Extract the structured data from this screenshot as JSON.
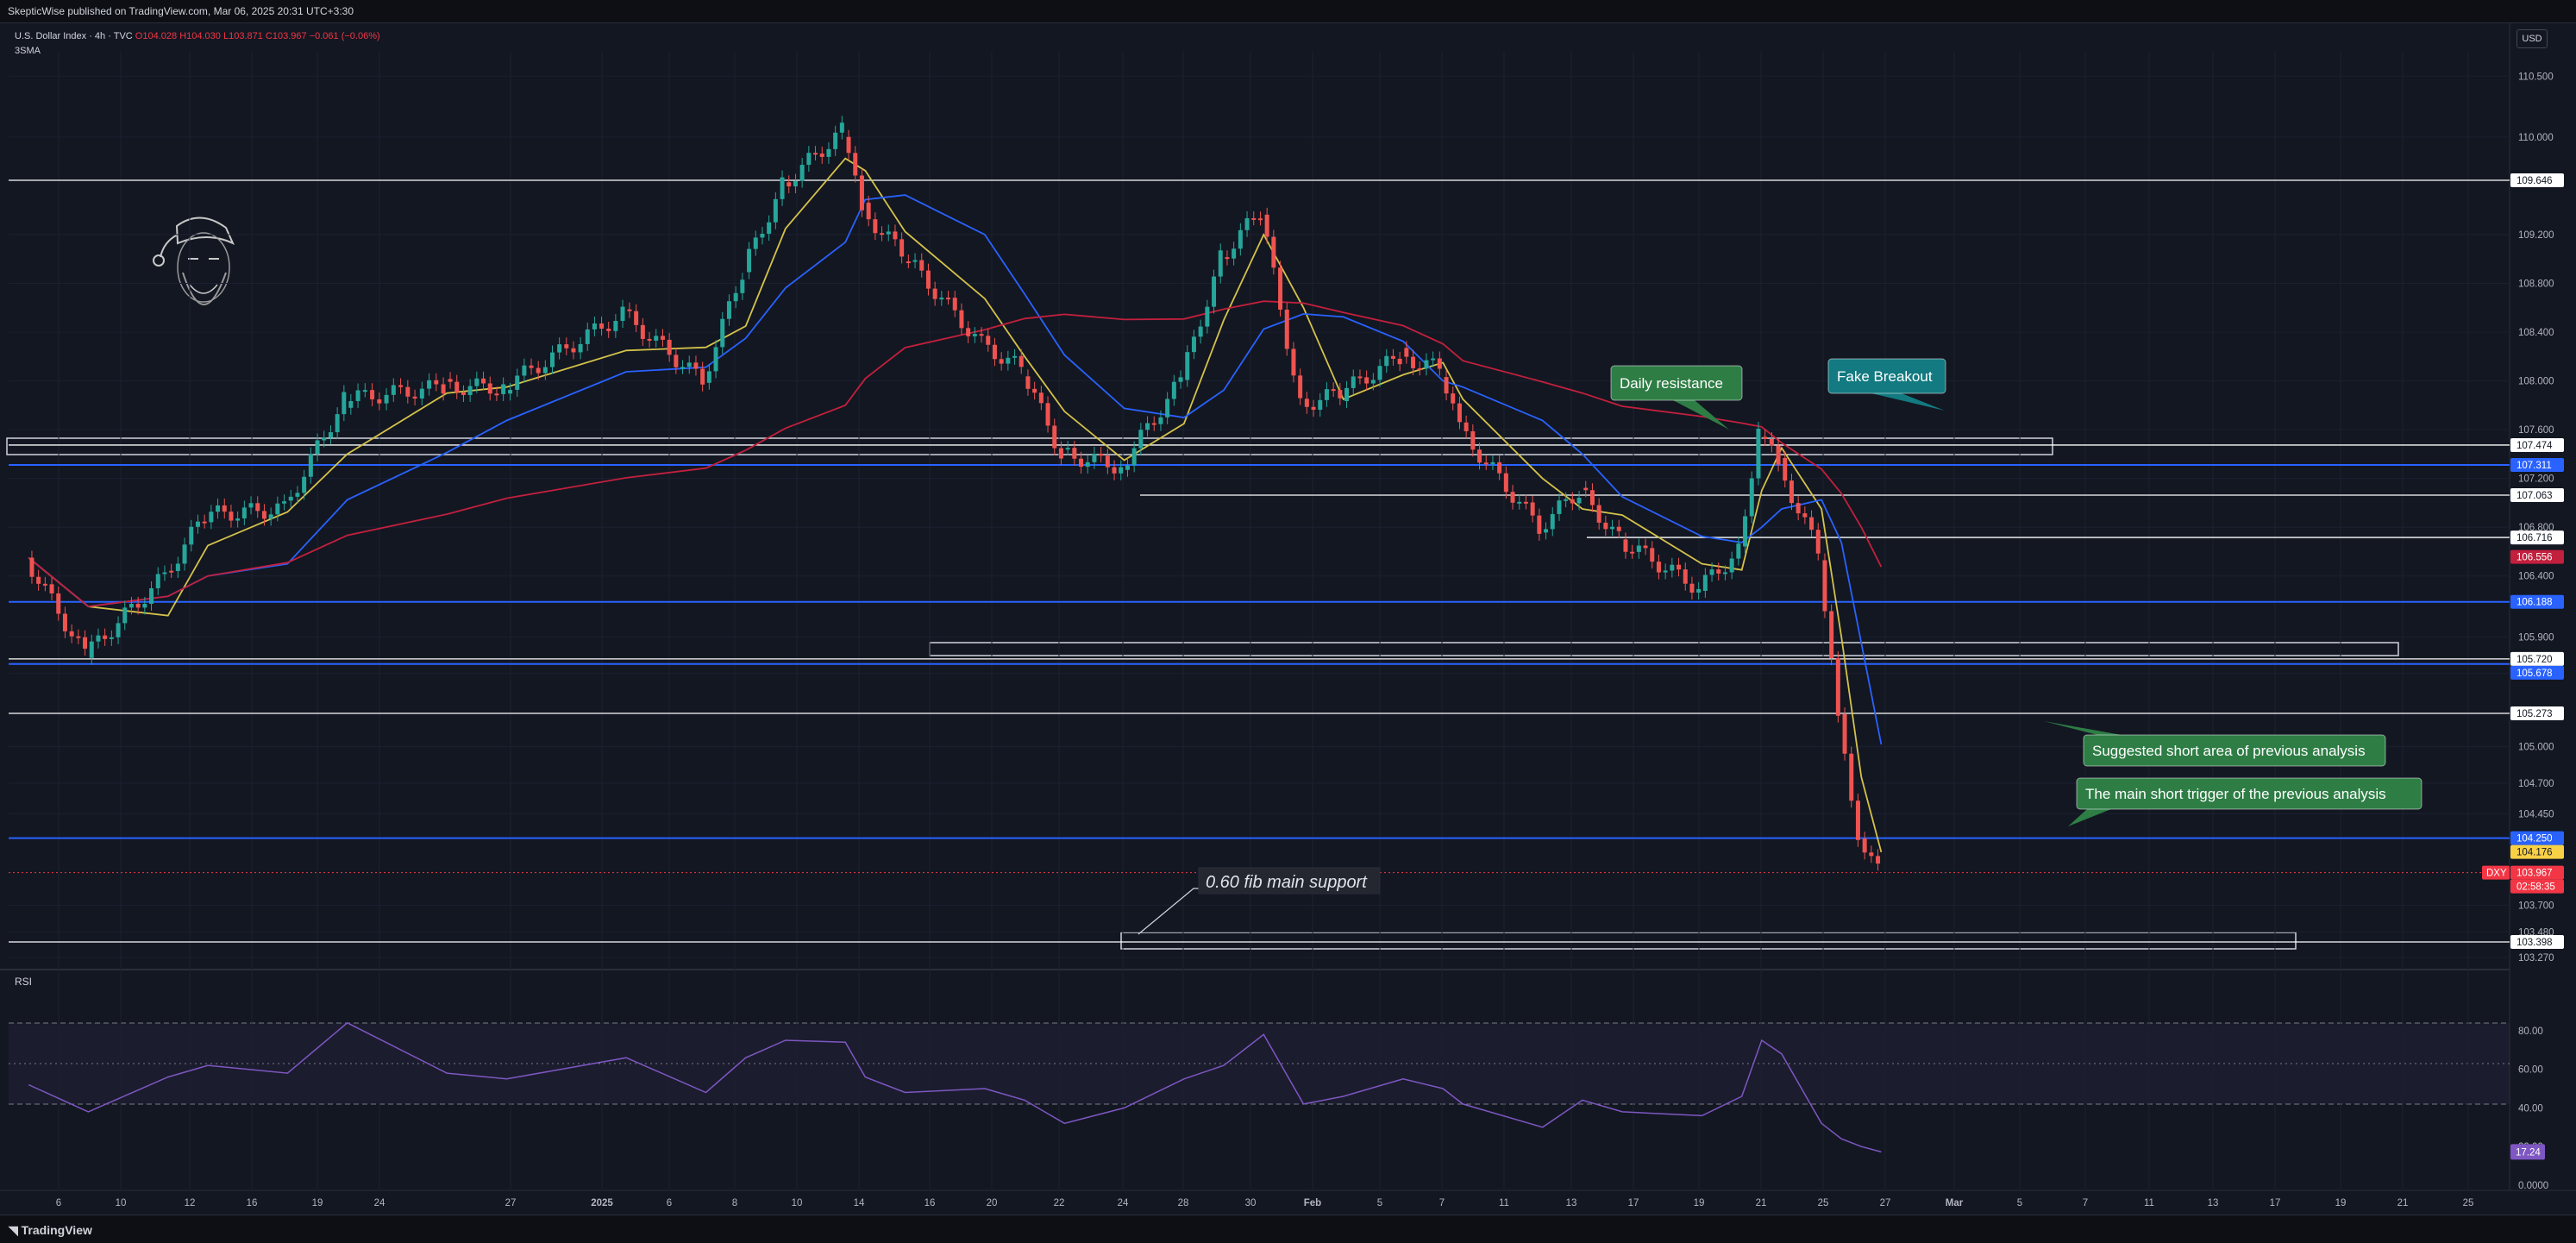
{
  "header": {
    "publish_line": "SkepticWise published on TradingView.com, Mar 06, 2025 20:31 UTC+3:30"
  },
  "legend": {
    "symbol": "U.S. Dollar Index · 4h · TVC",
    "open": "O104.028",
    "high": "H104.030",
    "low": "L103.871",
    "close": "C103.967",
    "change": "−0.061 (−0.06%)",
    "indicator": "3SMA"
  },
  "currency_button": "USD",
  "footer": {
    "brand": "TradingView"
  },
  "chart_data": {
    "type": "line",
    "symbol": "DXY",
    "timeframe": "4h",
    "ylim": [
      103.2,
      110.7
    ],
    "y_ticks": [
      "110.500",
      "110.000",
      "109.200",
      "108.800",
      "108.400",
      "108.000",
      "107.600",
      "107.200",
      "106.800",
      "106.400",
      "105.900",
      "105.600",
      "105.000",
      "104.700",
      "104.450",
      "103.700",
      "103.480",
      "103.270"
    ],
    "x_ticks": [
      "6",
      "10",
      "12",
      "16",
      "19",
      "24",
      "27",
      "2025",
      "6",
      "8",
      "10",
      "14",
      "16",
      "20",
      "22",
      "24",
      "28",
      "30",
      "Feb",
      "5",
      "7",
      "11",
      "13",
      "17",
      "19",
      "21",
      "25",
      "27",
      "Mar",
      "5",
      "7",
      "11",
      "13",
      "17",
      "19",
      "21",
      "25"
    ],
    "price_trend": [
      {
        "date": "Dec 03",
        "value": 106.55
      },
      {
        "date": "Dec 06",
        "value": 105.75
      },
      {
        "date": "Dec 10",
        "value": 106.4
      },
      {
        "date": "Dec 12",
        "value": 106.9
      },
      {
        "date": "Dec 16",
        "value": 106.95
      },
      {
        "date": "Dec 19",
        "value": 107.85
      },
      {
        "date": "Dec 24",
        "value": 107.95
      },
      {
        "date": "Dec 27",
        "value": 107.95
      },
      {
        "date": "Jan 02",
        "value": 108.55
      },
      {
        "date": "Jan 06",
        "value": 108.0
      },
      {
        "date": "Jan 08",
        "value": 108.9
      },
      {
        "date": "Jan 10",
        "value": 109.6
      },
      {
        "date": "Jan 13",
        "value": 110.05
      },
      {
        "date": "Jan 14",
        "value": 109.4
      },
      {
        "date": "Jan 16",
        "value": 109.05
      },
      {
        "date": "Jan 20",
        "value": 108.3
      },
      {
        "date": "Jan 22",
        "value": 108.1
      },
      {
        "date": "Jan 24",
        "value": 107.4
      },
      {
        "date": "Jan 27",
        "value": 107.3
      },
      {
        "date": "Jan 30",
        "value": 108.0
      },
      {
        "date": "Feb 01",
        "value": 109.0
      },
      {
        "date": "Feb 03",
        "value": 109.4
      },
      {
        "date": "Feb 05",
        "value": 107.8
      },
      {
        "date": "Feb 07",
        "value": 107.9
      },
      {
        "date": "Feb 10",
        "value": 108.2
      },
      {
        "date": "Feb 12",
        "value": 108.1
      },
      {
        "date": "Feb 13",
        "value": 107.6
      },
      {
        "date": "Feb 17",
        "value": 106.8
      },
      {
        "date": "Feb 19",
        "value": 107.1
      },
      {
        "date": "Feb 21",
        "value": 106.7
      },
      {
        "date": "Feb 25",
        "value": 106.3
      },
      {
        "date": "Feb 27",
        "value": 106.6
      },
      {
        "date": "Feb 28",
        "value": 107.6
      },
      {
        "date": "Mar 01",
        "value": 107.3
      },
      {
        "date": "Mar 03",
        "value": 106.6
      },
      {
        "date": "Mar 04",
        "value": 105.2
      },
      {
        "date": "Mar 05",
        "value": 104.3
      },
      {
        "date": "Mar 06",
        "value": 103.97
      }
    ],
    "moving_averages": [
      {
        "name": "",
        "color": "#d4c24a",
        "note": "fast"
      },
      {
        "name": "",
        "color": "#2962ff",
        "note": "medium"
      },
      {
        "name": "",
        "color": "#c2203d",
        "note": "slow"
      }
    ],
    "levels": [
      {
        "price": "109.646",
        "color": "#ffffff"
      },
      {
        "price": "107.474",
        "color": "#ffffff"
      },
      {
        "price": "107.311",
        "color": "#2962ff"
      },
      {
        "price": "107.063",
        "color": "#ffffff"
      },
      {
        "price": "106.716",
        "color": "#ffffff"
      },
      {
        "price": "106.188",
        "color": "#2962ff"
      },
      {
        "price": "105.720",
        "color": "#ffffff"
      },
      {
        "price": "105.678",
        "color": "#2962ff"
      },
      {
        "price": "105.273",
        "color": "#ffffff"
      },
      {
        "price": "104.250",
        "color": "#2962ff"
      },
      {
        "price": "103.398",
        "color": "#ffffff"
      }
    ],
    "price_labels": [
      {
        "text": "109.646",
        "bg": "#ffffff",
        "fg": "#131722"
      },
      {
        "text": "107.474",
        "bg": "#ffffff",
        "fg": "#131722"
      },
      {
        "text": "107.311",
        "bg": "#2962ff",
        "fg": "#ffffff"
      },
      {
        "text": "107.063",
        "bg": "#ffffff",
        "fg": "#131722"
      },
      {
        "text": "106.716",
        "bg": "#ffffff",
        "fg": "#131722"
      },
      {
        "text": "106.556",
        "bg": "#c2203d",
        "fg": "#ffffff"
      },
      {
        "text": "106.188",
        "bg": "#2962ff",
        "fg": "#ffffff"
      },
      {
        "text": "105.720",
        "bg": "#ffffff",
        "fg": "#131722"
      },
      {
        "text": "105.678",
        "bg": "#2962ff",
        "fg": "#ffffff"
      },
      {
        "text": "105.273",
        "bg": "#ffffff",
        "fg": "#131722"
      },
      {
        "text": "104.250",
        "bg": "#2962ff",
        "fg": "#ffffff"
      },
      {
        "text": "104.176",
        "bg": "#f7d046",
        "fg": "#131722"
      },
      {
        "text": "103.967",
        "bg": "#f23645",
        "fg": "#ffffff"
      },
      {
        "text": "02:58:35",
        "bg": "#f23645",
        "fg": "#ffffff"
      },
      {
        "text": "103.398",
        "bg": "#ffffff",
        "fg": "#131722"
      }
    ],
    "symbol_tag": "DXY",
    "annotations": [
      {
        "text": "Daily resistance",
        "bg": "#2e7d45"
      },
      {
        "text": "Fake Breakout",
        "bg": "#127a80"
      },
      {
        "text": "Suggested short area of previous analysis",
        "bg": "#2e7d45"
      },
      {
        "text": "The main short trigger of the previous analysis",
        "bg": "#2e7d45"
      }
    ],
    "fib_label": "0.60 fib main support",
    "rsi": {
      "label": "RSI",
      "ylim": [
        0,
        100
      ],
      "ticks": [
        "80.00",
        "60.00",
        "40.00",
        "20.00",
        "0.0000"
      ],
      "band": [
        30,
        70
      ],
      "midline": 50,
      "current": "17.24",
      "color": "#7e57c2",
      "series": [
        {
          "date": "Dec 03",
          "value": 52
        },
        {
          "date": "Dec 06",
          "value": 38
        },
        {
          "date": "Dec 10",
          "value": 56
        },
        {
          "date": "Dec 12",
          "value": 62
        },
        {
          "date": "Dec 16",
          "value": 58
        },
        {
          "date": "Dec 19",
          "value": 84
        },
        {
          "date": "Dec 24",
          "value": 58
        },
        {
          "date": "Dec 27",
          "value": 55
        },
        {
          "date": "Jan 02",
          "value": 66
        },
        {
          "date": "Jan 06",
          "value": 48
        },
        {
          "date": "Jan 08",
          "value": 66
        },
        {
          "date": "Jan 10",
          "value": 75
        },
        {
          "date": "Jan 13",
          "value": 74
        },
        {
          "date": "Jan 14",
          "value": 56
        },
        {
          "date": "Jan 16",
          "value": 48
        },
        {
          "date": "Jan 20",
          "value": 50
        },
        {
          "date": "Jan 22",
          "value": 44
        },
        {
          "date": "Jan 24",
          "value": 32
        },
        {
          "date": "Jan 27",
          "value": 40
        },
        {
          "date": "Jan 30",
          "value": 55
        },
        {
          "date": "Feb 01",
          "value": 62
        },
        {
          "date": "Feb 03",
          "value": 78
        },
        {
          "date": "Feb 05",
          "value": 42
        },
        {
          "date": "Feb 07",
          "value": 46
        },
        {
          "date": "Feb 10",
          "value": 55
        },
        {
          "date": "Feb 12",
          "value": 50
        },
        {
          "date": "Feb 13",
          "value": 42
        },
        {
          "date": "Feb 17",
          "value": 30
        },
        {
          "date": "Feb 19",
          "value": 44
        },
        {
          "date": "Feb 21",
          "value": 38
        },
        {
          "date": "Feb 25",
          "value": 36
        },
        {
          "date": "Feb 27",
          "value": 46
        },
        {
          "date": "Feb 28",
          "value": 75
        },
        {
          "date": "Mar 01",
          "value": 68
        },
        {
          "date": "Mar 03",
          "value": 32
        },
        {
          "date": "Mar 04",
          "value": 24
        },
        {
          "date": "Mar 05",
          "value": 20
        },
        {
          "date": "Mar 06",
          "value": 17.24
        }
      ]
    }
  }
}
